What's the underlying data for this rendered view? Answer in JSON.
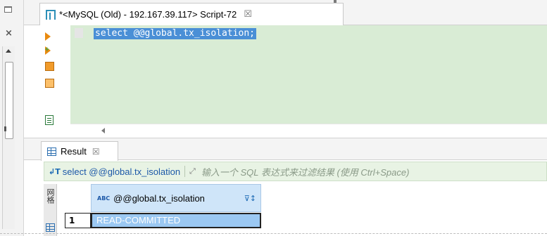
{
  "window": {
    "tab_title": "*<MySQL (Old) - 192.167.39.117> Script-72",
    "tab_close_glyph": "☒"
  },
  "editor": {
    "code": "select @@global.tx_isolation;",
    "background": "#d9ecd5",
    "selection_color": "#4a8fd6"
  },
  "toolbar_icons": [
    "execute-statement-icon",
    "execute-in-new-tab-icon",
    "execute-script-icon",
    "execute-script-new-tab-icon",
    "explain-plan-icon"
  ],
  "result_panel": {
    "tab_label": "Result",
    "tab_close_glyph": "☒",
    "filter": {
      "query": "select @@global.tx_isolation",
      "placeholder": "输入一个 SQL 表达式来过滤结果 (使用 Ctrl+Space)"
    },
    "side_tab_label": "网格",
    "columns": [
      {
        "type_badge": "ABC",
        "name": "@@global.tx_isolation"
      }
    ],
    "rows": [
      {
        "row_number": "1",
        "values": [
          "READ-COMMITTED"
        ]
      }
    ]
  }
}
